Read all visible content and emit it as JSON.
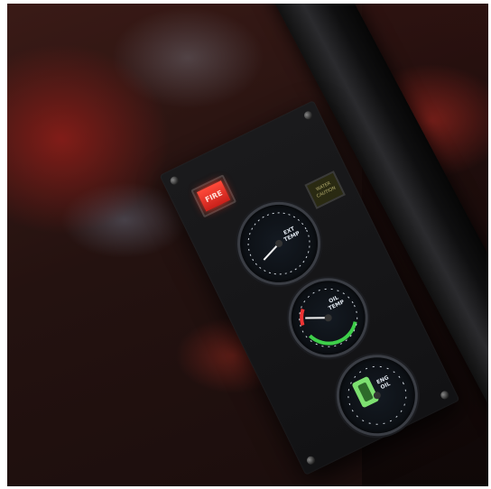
{
  "fire_button": {
    "label": "FIRE"
  },
  "annunciator": {
    "line1": "WATER",
    "line2": "CAUTION"
  },
  "gauge1": {
    "label1": "EXT",
    "label2": "TEMP"
  },
  "gauge2": {
    "label1": "OIL",
    "label2": "TEMP"
  },
  "gauge3": {
    "label1": "ENG",
    "label2": "OIL"
  },
  "colors": {
    "fire": "#e0281e",
    "green_arc": "#3ecf4a",
    "red_mark": "#e33",
    "panel": "#141416"
  }
}
